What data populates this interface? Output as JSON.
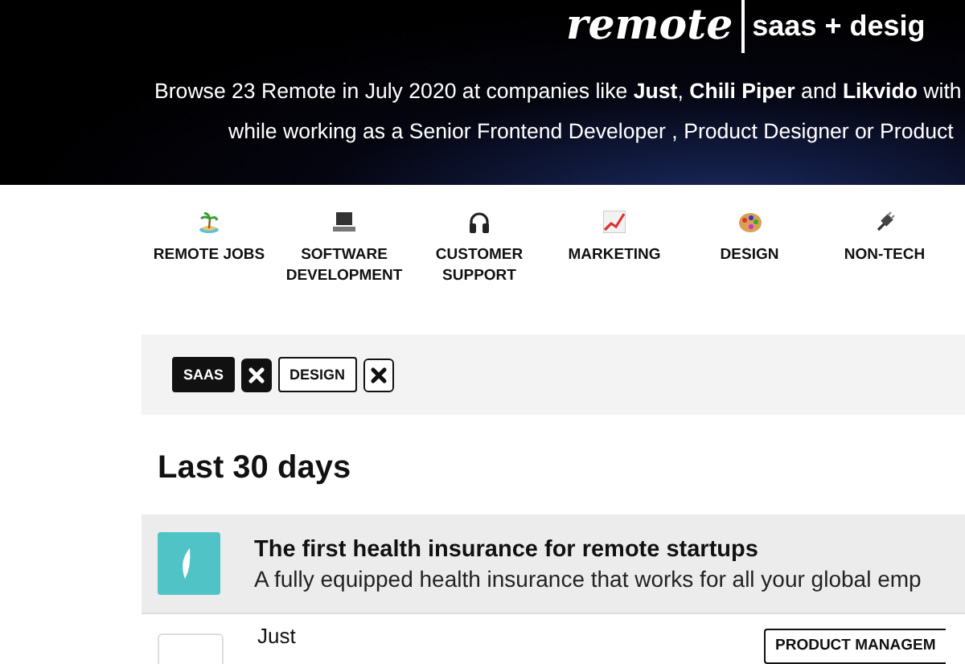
{
  "header": {
    "logo": "remote",
    "subtitle": "saas + desig",
    "lines": [
      "Browse 23 Remote in July 2020 at companies like **Just**, **Chili Piper** and **Likvido** with",
      "while working as a Senior Frontend Developer , Product Designer or Product"
    ]
  },
  "categories": [
    {
      "label": "REMOTE JOBS",
      "kind": "island"
    },
    {
      "label": "SOFTWARE DEVELOPMENT",
      "kind": "laptop"
    },
    {
      "label": "CUSTOMER SUPPORT",
      "kind": "headphones"
    },
    {
      "label": "MARKETING",
      "kind": "chart"
    },
    {
      "label": "DESIGN",
      "kind": "palette"
    },
    {
      "label": "NON-TECH",
      "kind": "plug"
    }
  ],
  "filters": [
    {
      "label": "SAAS",
      "selected": true
    },
    {
      "label": "DESIGN",
      "selected": false
    }
  ],
  "section_title": "Last 30 days",
  "promo": {
    "title": "The first health insurance for remote startups",
    "description": "A fully equipped health insurance that works for all your global emp"
  },
  "job": {
    "company": "Just",
    "tag": "PRODUCT MANAGEM"
  }
}
